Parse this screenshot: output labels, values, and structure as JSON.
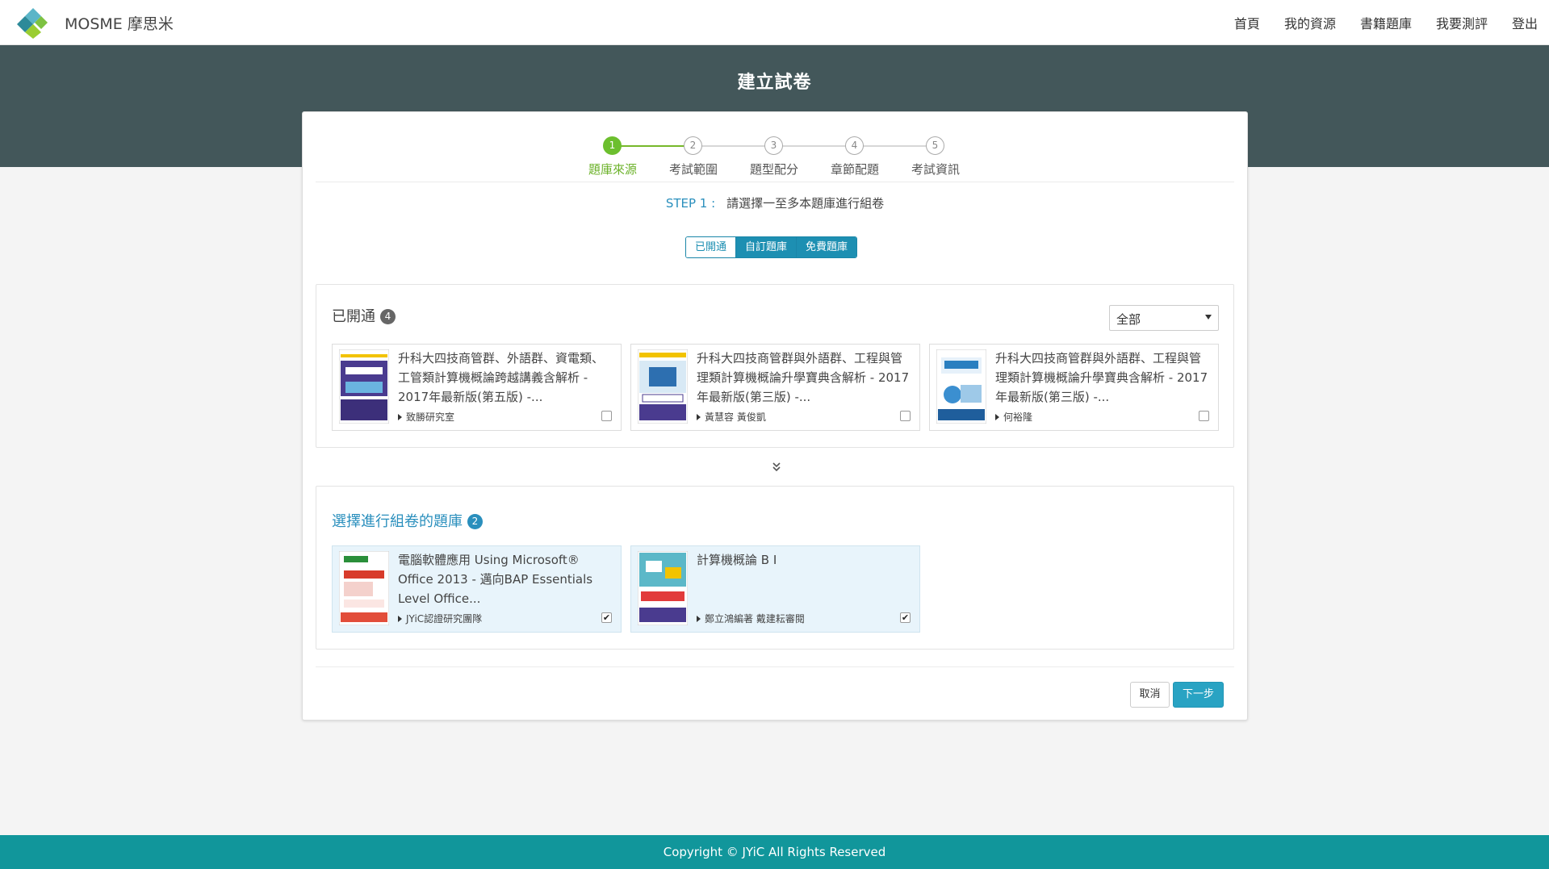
{
  "nav": {
    "brand": "MOSME 摩思米",
    "links": [
      "首頁",
      "我的資源",
      "書籍題庫",
      "我要測評",
      "登出"
    ]
  },
  "page": {
    "title": "建立試卷"
  },
  "steps": [
    {
      "num": "1",
      "label": "題庫來源",
      "active": true
    },
    {
      "num": "2",
      "label": "考試範圍",
      "active": false
    },
    {
      "num": "3",
      "label": "題型配分",
      "active": false
    },
    {
      "num": "4",
      "label": "章節配題",
      "active": false
    },
    {
      "num": "5",
      "label": "考試資訊",
      "active": false
    }
  ],
  "instruction": {
    "step": "STEP 1 :",
    "text": "請選擇一至多本題庫進行組卷"
  },
  "tabs": [
    "已開通",
    "自訂題庫",
    "免費題庫"
  ],
  "opened": {
    "title": "已開通",
    "count": "4",
    "filter": "全部",
    "books": [
      {
        "title": "升科大四技商管群、外語群、資電類、工管類計算機概論跨越講義含解析 - 2017年最新版(第五版) -...",
        "author": "致勝研究室",
        "checked": false
      },
      {
        "title": "升科大四技商管群與外語群、工程與管理類計算機概論升學寶典含解析 - 2017年最新版(第三版) -...",
        "author": "黃慧容 黃俊凱",
        "checked": false
      },
      {
        "title": "升科大四技商管群與外語群、工程與管理類計算機概論升學寶典含解析 - 2017年最新版(第三版) -...",
        "author": "何裕隆",
        "checked": false
      }
    ]
  },
  "selected": {
    "title": "選擇進行組卷的題庫",
    "count": "2",
    "books": [
      {
        "title": "電腦軟體應用 Using Microsoft® Office 2013 - 邁向BAP Essentials Level Office...",
        "author": "JYiC認證研究團隊",
        "checked": true
      },
      {
        "title": "計算機概論 B I",
        "author": "鄭立鴻編著 戴建耘審閱",
        "checked": true
      }
    ]
  },
  "buttons": {
    "cancel": "取消",
    "next": "下一步"
  },
  "footer": {
    "text": "Copyright © JYiC All Rights Reserved"
  },
  "colors": {
    "accent": "#1d8fb2",
    "step_active": "#6cbf2e",
    "band": "#43575a",
    "footer": "#11969b"
  }
}
